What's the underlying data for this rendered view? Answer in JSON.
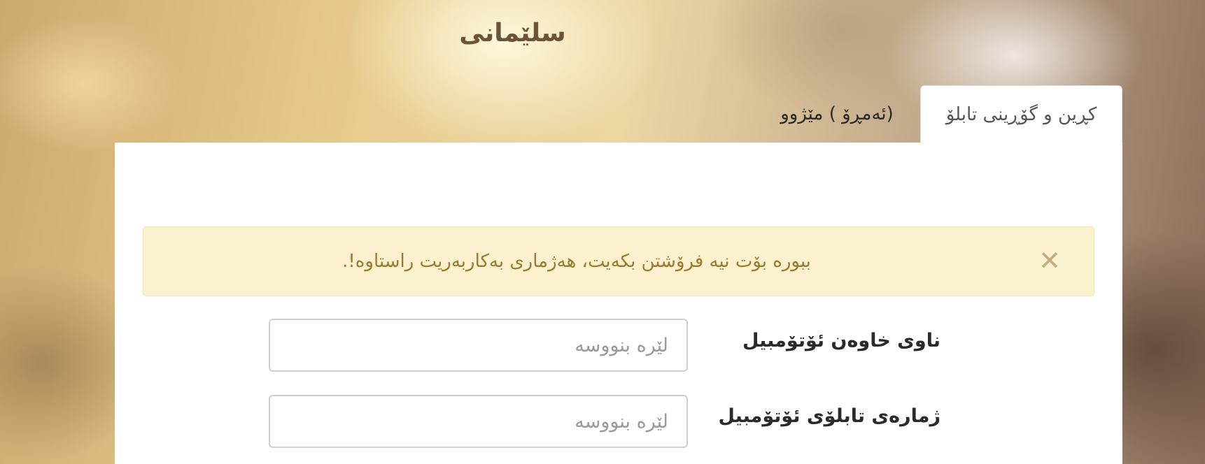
{
  "header": {
    "title": "سلێمانی"
  },
  "tabs": [
    {
      "label": "کڕین و گۆڕینی تابلۆ",
      "active": true
    },
    {
      "label": "(ئەمڕۆ ) مێژوو",
      "active": false
    }
  ],
  "alert": {
    "message": "ببورە بۆت نیە فرۆشتن بکەیت، هەژماری بەکاربەریت راستاوە!.",
    "close_icon": "close-icon",
    "background": "#fcf1cf",
    "text_color": "#9a7a2e"
  },
  "form": {
    "owner_name": {
      "label": "ناوی خاوەن ئۆتۆمبیل",
      "value": "",
      "placeholder": "لێرە بنووسە"
    },
    "plate_number": {
      "label": "ژمارەی تابلۆی ئۆتۆمبیل",
      "value": "",
      "placeholder": "لێرە بنووسە"
    }
  }
}
